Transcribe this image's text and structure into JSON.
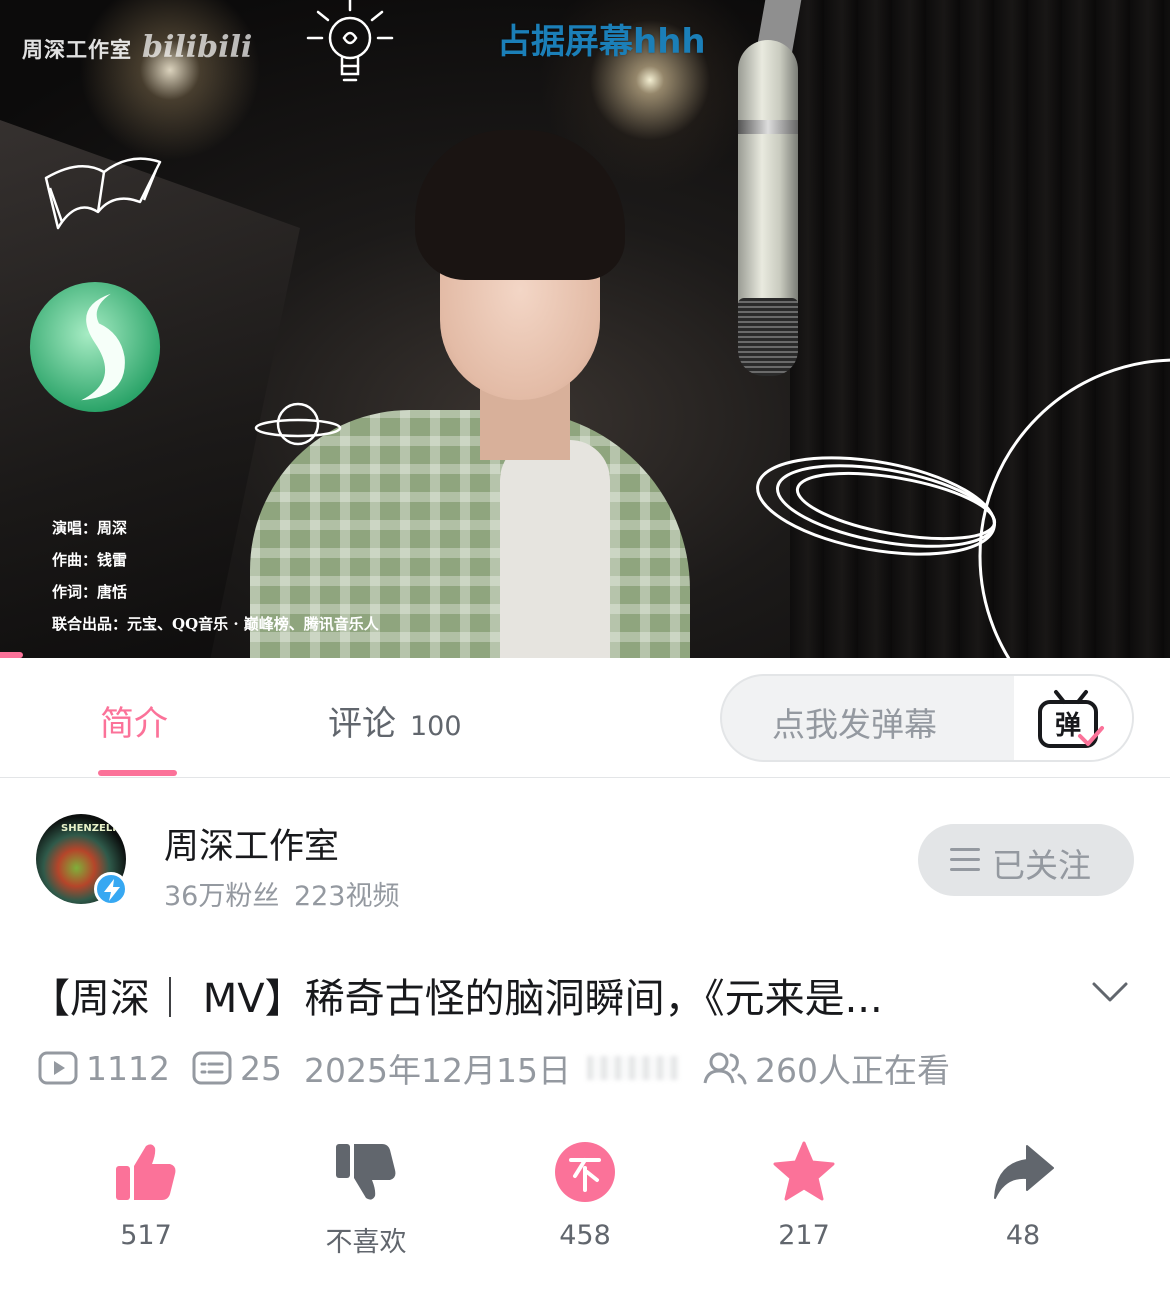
{
  "video": {
    "watermark": "周深工作室",
    "watermark_logo": "bilibili",
    "danmaku_text": "占据屏幕hhh",
    "credits": [
      "演唱：周深",
      "作曲：钱雷",
      "作词：唐恬",
      "联合出品：元宝、QQ音乐 · 巅峰榜、腾讯音乐人"
    ],
    "progress_fraction": 0.02
  },
  "tabs": [
    {
      "label": "简介",
      "count": ""
    },
    {
      "label": "评论",
      "count": "100"
    }
  ],
  "danmaku_input": {
    "placeholder": "点我发弹幕",
    "button_label": "弹"
  },
  "uploader": {
    "name": "周深工作室",
    "fans": "36万粉丝",
    "videos": "223视频",
    "avatar_text": "SHENZELF",
    "follow_label": "已关注"
  },
  "title": "【周深｜ MV】稀奇古怪的脑洞瞬间，《元来是...",
  "meta": {
    "views": "1112",
    "danmaku_count": "25",
    "date": "2025年12月15日",
    "watching": "260人正在看"
  },
  "actions": [
    {
      "name": "like",
      "label": "517",
      "icon": "thumbs-up-icon"
    },
    {
      "name": "dislike",
      "label": "不喜欢",
      "icon": "thumbs-down-icon"
    },
    {
      "name": "coin",
      "label": "458",
      "icon": "coin-icon"
    },
    {
      "name": "favorite",
      "label": "217",
      "icon": "star-icon"
    },
    {
      "name": "share",
      "label": "48",
      "icon": "share-icon"
    }
  ],
  "colors": {
    "accent": "#fb7299",
    "danmaku": "#1b7fb8",
    "verified": "#37a8f2",
    "muted": "#9499a0"
  }
}
